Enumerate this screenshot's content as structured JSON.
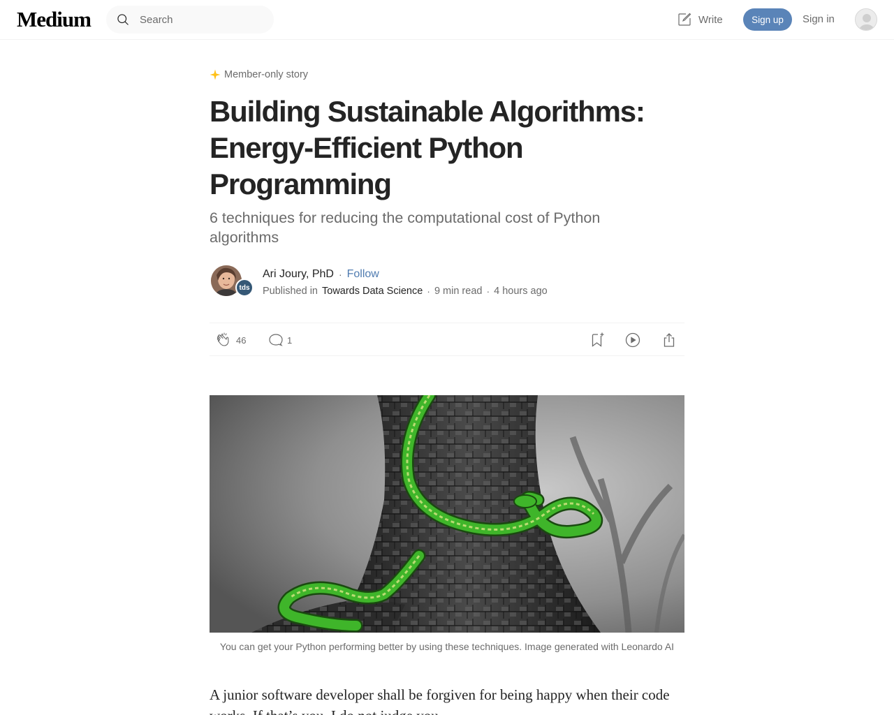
{
  "header": {
    "logo": "Medium",
    "search_placeholder": "Search",
    "write_label": "Write",
    "signup_label": "Sign up",
    "signin_label": "Sign in"
  },
  "article": {
    "member_label": "Member-only story",
    "title": "Building Sustainable Algorithms: Energy-Efficient Python Programming",
    "subtitle": "6 techniques for reducing the computational cost of Python algorithms",
    "author": {
      "name": "Ari Joury, PhD",
      "follow_label": "Follow",
      "published_in_label": "Published in",
      "publication": "Towards Data Science",
      "publication_badge": "tds",
      "read_time": "9 min read",
      "published_ago": "4 hours ago"
    },
    "actions": {
      "claps": "46",
      "responses": "1"
    },
    "image_caption": "You can get your Python performing better by using these techniques. Image generated with Leonardo AI",
    "body_first_paragraph": "A junior software developer shall be forgiven for being happy when their code works. If that’s you, I do not judge you."
  },
  "colors": {
    "accent_signup": "#5a84b8",
    "follow_link": "#4f7bb0",
    "member_star": "#ffc017",
    "text_primary": "#242424",
    "text_secondary": "#6b6b6b"
  },
  "icons": [
    "search-icon",
    "write-icon",
    "member-star-icon",
    "clap-icon",
    "response-icon",
    "bookmark-icon",
    "listen-icon",
    "share-icon"
  ]
}
